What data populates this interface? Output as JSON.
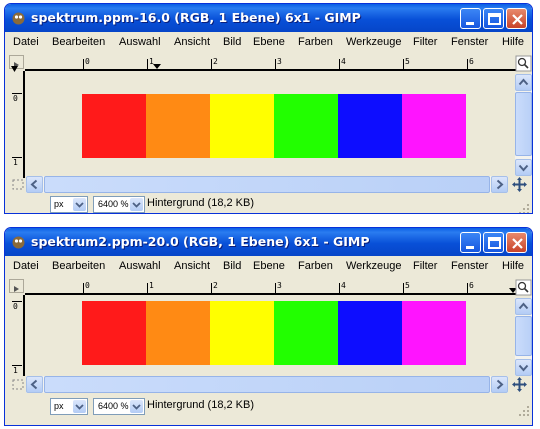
{
  "windows": [
    {
      "title": "spektrum.ppm-16.0 (RGB, 1 Ebene) 6x1 - GIMP",
      "menu": [
        "Datei",
        "Bearbeiten",
        "Auswahl",
        "Ansicht",
        "Bild",
        "Ebene",
        "Farben",
        "Werkzeuge",
        "Filter",
        "Fenster",
        "Hilfe"
      ],
      "ruler_h": [
        "0",
        "1",
        "2",
        "3",
        "4",
        "5",
        "6"
      ],
      "ruler_v": [
        "0",
        "1"
      ],
      "status": {
        "unit": "px",
        "zoom": "6400 %",
        "layer_info": "Hintergrund (18,2 KB)"
      }
    },
    {
      "title": "spektrum2.ppm-20.0 (RGB, 1 Ebene) 6x1 - GIMP",
      "menu": [
        "Datei",
        "Bearbeiten",
        "Auswahl",
        "Ansicht",
        "Bild",
        "Ebene",
        "Farben",
        "Werkzeuge",
        "Filter",
        "Fenster",
        "Hilfe"
      ],
      "ruler_h": [
        "0",
        "1",
        "2",
        "3",
        "4",
        "5",
        "6"
      ],
      "ruler_v": [
        "0",
        "1"
      ],
      "status": {
        "unit": "px",
        "zoom": "6400 %",
        "layer_info": "Hintergrund (18,2 KB)"
      }
    }
  ],
  "spectrum_colors": [
    "#ff1a1a",
    "#ff8a14",
    "#ffff00",
    "#22ff00",
    "#0d0dff",
    "#ff14ff"
  ],
  "icons": [
    "gimp-icon",
    "minimize-icon",
    "maximize-icon",
    "close-icon",
    "navigate-icon",
    "zoom-icon",
    "scroll-left-icon",
    "scroll-right-icon",
    "scroll-up-icon",
    "scroll-down-icon",
    "quickmask-icon",
    "chevron-down-icon"
  ]
}
